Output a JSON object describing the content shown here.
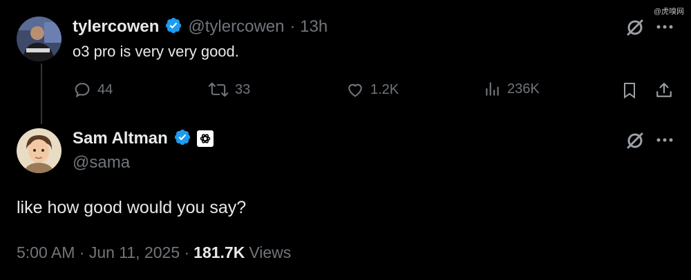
{
  "watermark": "@虎嗅网",
  "tweet1": {
    "display_name": "tylercowen",
    "handle": "@tylercowen",
    "time": "· 13h",
    "text": "o3 pro is very very good.",
    "replies": "44",
    "reposts": "33",
    "likes": "1.2K",
    "views": "236K",
    "icons": [
      "verified-icon",
      "grok-icon",
      "more-icon",
      "reply-icon",
      "repost-icon",
      "like-icon",
      "views-icon",
      "bookmark-icon",
      "share-icon"
    ]
  },
  "tweet2": {
    "display_name": "Sam Altman",
    "handle": "@sama",
    "text": "like how good would you say?",
    "timestamp": "5:00 AM · Jun 11, 2025 ·",
    "views_count": "181.7K",
    "views_label": "Views",
    "icons": [
      "verified-icon",
      "openai-affiliate-icon",
      "grok-icon",
      "more-icon"
    ]
  },
  "colors": {
    "background": "#000000",
    "text": "#e7e9ea",
    "secondary": "#71767b",
    "verified": "#1d9bf0"
  }
}
